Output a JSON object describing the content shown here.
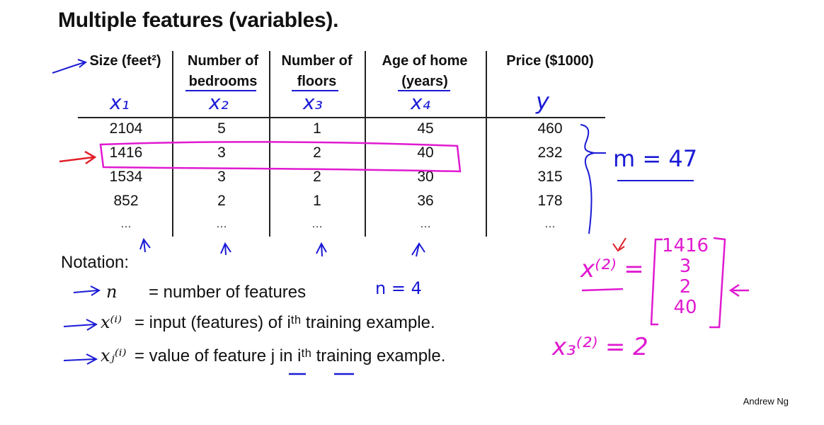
{
  "title": "Multiple features (variables).",
  "table": {
    "headers": [
      "Size (feet²)",
      "Number of bedrooms",
      "Number of floors",
      "Age of home (years)",
      "Price ($1000)"
    ],
    "header_lines": [
      [
        "Size (feet²)"
      ],
      [
        "Number of",
        "bedrooms"
      ],
      [
        "Number of",
        "floors"
      ],
      [
        "Age of home",
        "(years)"
      ],
      [
        "Price ($1000)"
      ]
    ],
    "rows": [
      [
        "2104",
        "5",
        "1",
        "45",
        "460"
      ],
      [
        "1416",
        "3",
        "2",
        "40",
        "232"
      ],
      [
        "1534",
        "3",
        "2",
        "30",
        "315"
      ],
      [
        "852",
        "2",
        "1",
        "36",
        "178"
      ],
      [
        "…",
        "…",
        "…",
        "…",
        "…"
      ]
    ],
    "highlighted_row": 1
  },
  "handwriting": {
    "feature_labels": [
      "x₁",
      "x₂",
      "x₃",
      "x₄",
      "y"
    ],
    "m_label": "m = 47",
    "n_label": "n = 4",
    "vector_label": "x⁽²⁾ =",
    "vector_values": [
      "1416",
      "3",
      "2",
      "40"
    ],
    "element_label": "x₃⁽²⁾ = 2",
    "ink_blue": "#1a1ad6",
    "ink_magenta": "#e01ad0",
    "ink_red": "#e0202a"
  },
  "notation": {
    "heading": "Notation:",
    "items": [
      {
        "symbol": "n",
        "text": "= number of features"
      },
      {
        "symbol": "x⁽ⁱ⁾",
        "text": "= input (features) of iᵗʰ training example."
      },
      {
        "symbol": "xⱼ⁽ⁱ⁾",
        "text": "= value of feature j in iᵗʰ training example."
      }
    ]
  },
  "signature": "Andrew Ng"
}
